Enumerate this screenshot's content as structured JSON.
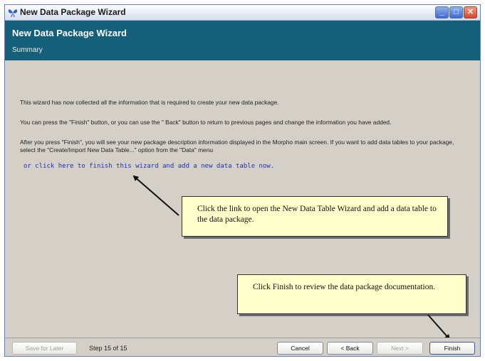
{
  "window": {
    "title": "New Data Package Wizard"
  },
  "header": {
    "title": "New Data Package Wizard",
    "subtitle": "Summary"
  },
  "content": {
    "paragraph_1": "This wizard has now collected all the information that is required to create your new data package.",
    "paragraph_2": "You can press the \"Finish\" button, or you can use the \" Back\" button to return to previous pages and change the information you have added.",
    "paragraph_3": "After you press \"Finish\", you will see your new package description information displayed in the Morpho main screen. If you want to add data tables to your package, select the \"Create/Import New Data Table...\" option from the \"Data\" menu",
    "link_text": "or click here to finish this wizard and add a new data table now."
  },
  "callouts": {
    "link_note": "Click the link to open the New Data Table Wizard and add a data table to the data package.",
    "finish_note": "Click Finish to review the data package documentation."
  },
  "footer": {
    "save_label": "Save for Later",
    "step_text": "Step 15 of 15",
    "cancel_label": "Cancel",
    "back_label": "< Back",
    "next_label": "Next >",
    "finish_label": "Finish"
  },
  "colors": {
    "header_bg": "#145f7a",
    "link": "#1f2fb4",
    "callout_bg": "#ffffcc"
  },
  "icons": {
    "app": "morpho-butterfly-icon",
    "minimize": "minimize-icon",
    "maximize": "maximize-icon",
    "close": "close-icon"
  }
}
